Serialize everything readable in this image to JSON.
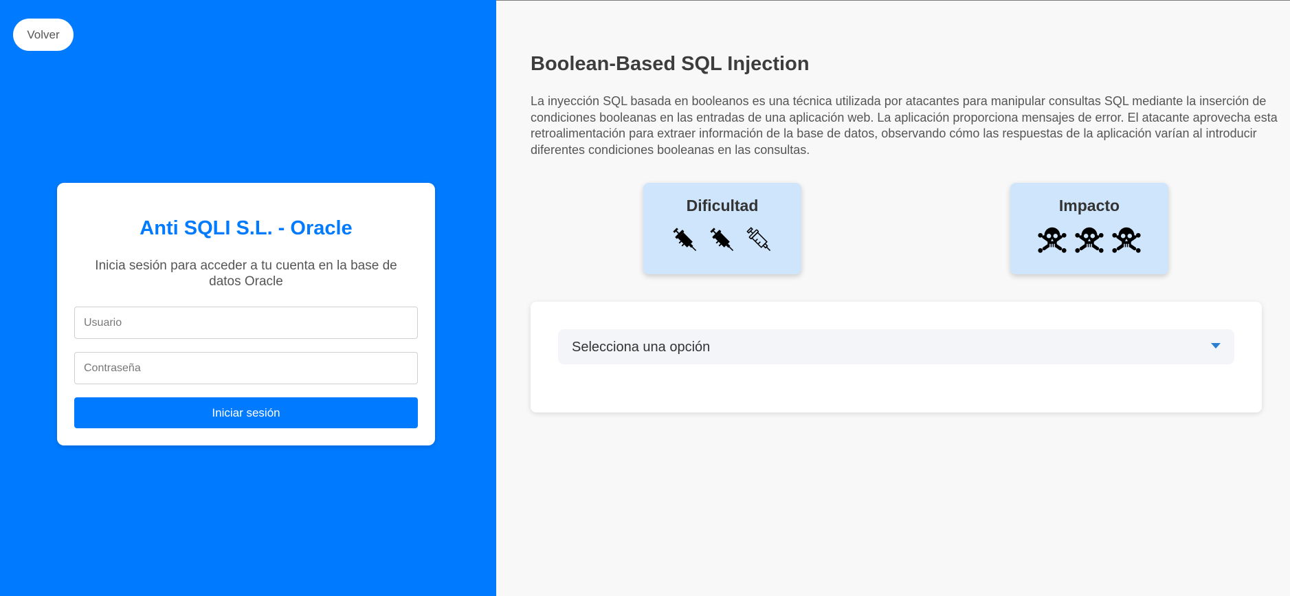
{
  "header": {
    "back_label": "Volver"
  },
  "login": {
    "title": "Anti SQLI S.L. - Oracle",
    "subtitle": "Inicia sesión para acceder a tu cuenta en la base de datos Oracle",
    "username_placeholder": "Usuario",
    "password_placeholder": "Contraseña",
    "submit_label": "Iniciar sesión"
  },
  "main": {
    "title": "Boolean-Based SQL Injection",
    "description": "La inyección SQL basada en booleanos es una técnica utilizada por atacantes para manipular consultas SQL mediante la inserción de condiciones booleanas en las entradas de una aplicación web. La aplicación proporciona mensajes de error. El atacante aprovecha esta retroalimentación para extraer información de la base de datos, observando cómo las respuestas de la aplicación varían al introducir diferentes condiciones booleanas en las consultas.",
    "difficulty": {
      "label": "Dificultad",
      "icons": [
        "syringe-filled-icon",
        "syringe-filled-icon",
        "syringe-outline-icon"
      ],
      "rating": 2,
      "max": 3
    },
    "impact": {
      "label": "Impacto",
      "icons": [
        "skull-crossbones-icon",
        "skull-crossbones-icon",
        "skull-crossbones-icon"
      ],
      "rating": 3,
      "max": 3
    },
    "select": {
      "selected_label": "Selecciona una opción",
      "icon": "chevron-down-icon"
    }
  },
  "colors": {
    "primary": "#007bff",
    "card_highlight": "#cfe5fc",
    "page_background": "#f8f8f8",
    "text_dark": "#3d3d3d",
    "text_body": "#555555"
  }
}
